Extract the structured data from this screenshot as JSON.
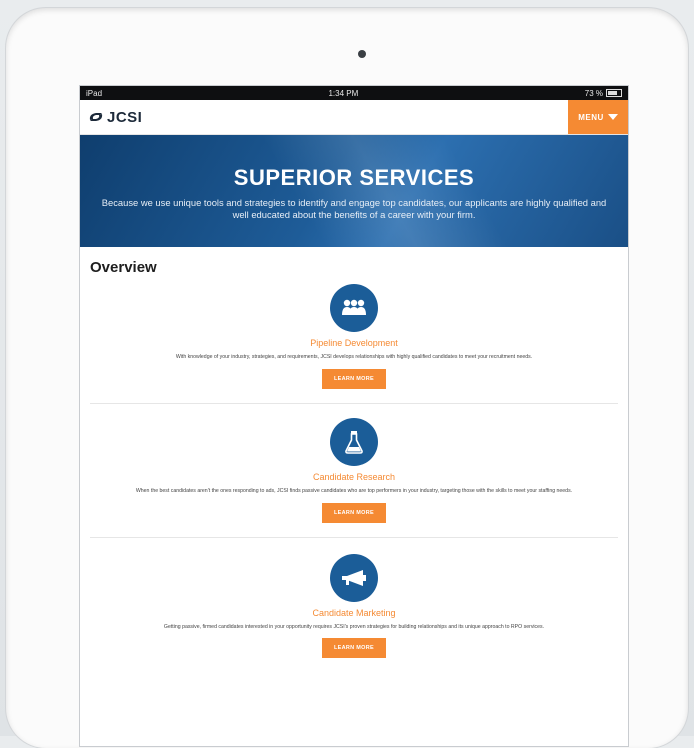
{
  "statusbar": {
    "device": "iPad",
    "time": "1:34 PM",
    "battery": "73 %"
  },
  "nav": {
    "logo_text": "JCSI",
    "menu_label": "MENU"
  },
  "hero": {
    "title": "SUPERIOR SERVICES",
    "subtitle": "Because we use unique tools and strategies to identify and engage top candidates, our applicants are highly qualified and well educated about the benefits of a career with your firm."
  },
  "overview": {
    "title": "Overview"
  },
  "services": [
    {
      "icon": "people-icon",
      "name": "Pipeline Development",
      "description": "With knowledge of your industry, strategies, and requirements, JCSI develops relationships with highly qualified candidates to meet your recruitment needs.",
      "button": "LEARN MORE"
    },
    {
      "icon": "flask-icon",
      "name": "Candidate Research",
      "description": "When the best candidates aren't the ones responding to ads, JCSI finds passive candidates who are top performers in your industry, targeting those with the skills to meet your staffing needs.",
      "button": "LEARN MORE"
    },
    {
      "icon": "megaphone-icon",
      "name": "Candidate Marketing",
      "description": "Getting passive, firmed candidates interested in your opportunity requires JCSI's proven strategies for building relationships and its unique approach to RPO services.",
      "button": "LEARN MORE"
    }
  ],
  "colors": {
    "accent": "#f58a33",
    "brand_blue": "#1b5d98",
    "hero_blue": "#1e5c98"
  }
}
